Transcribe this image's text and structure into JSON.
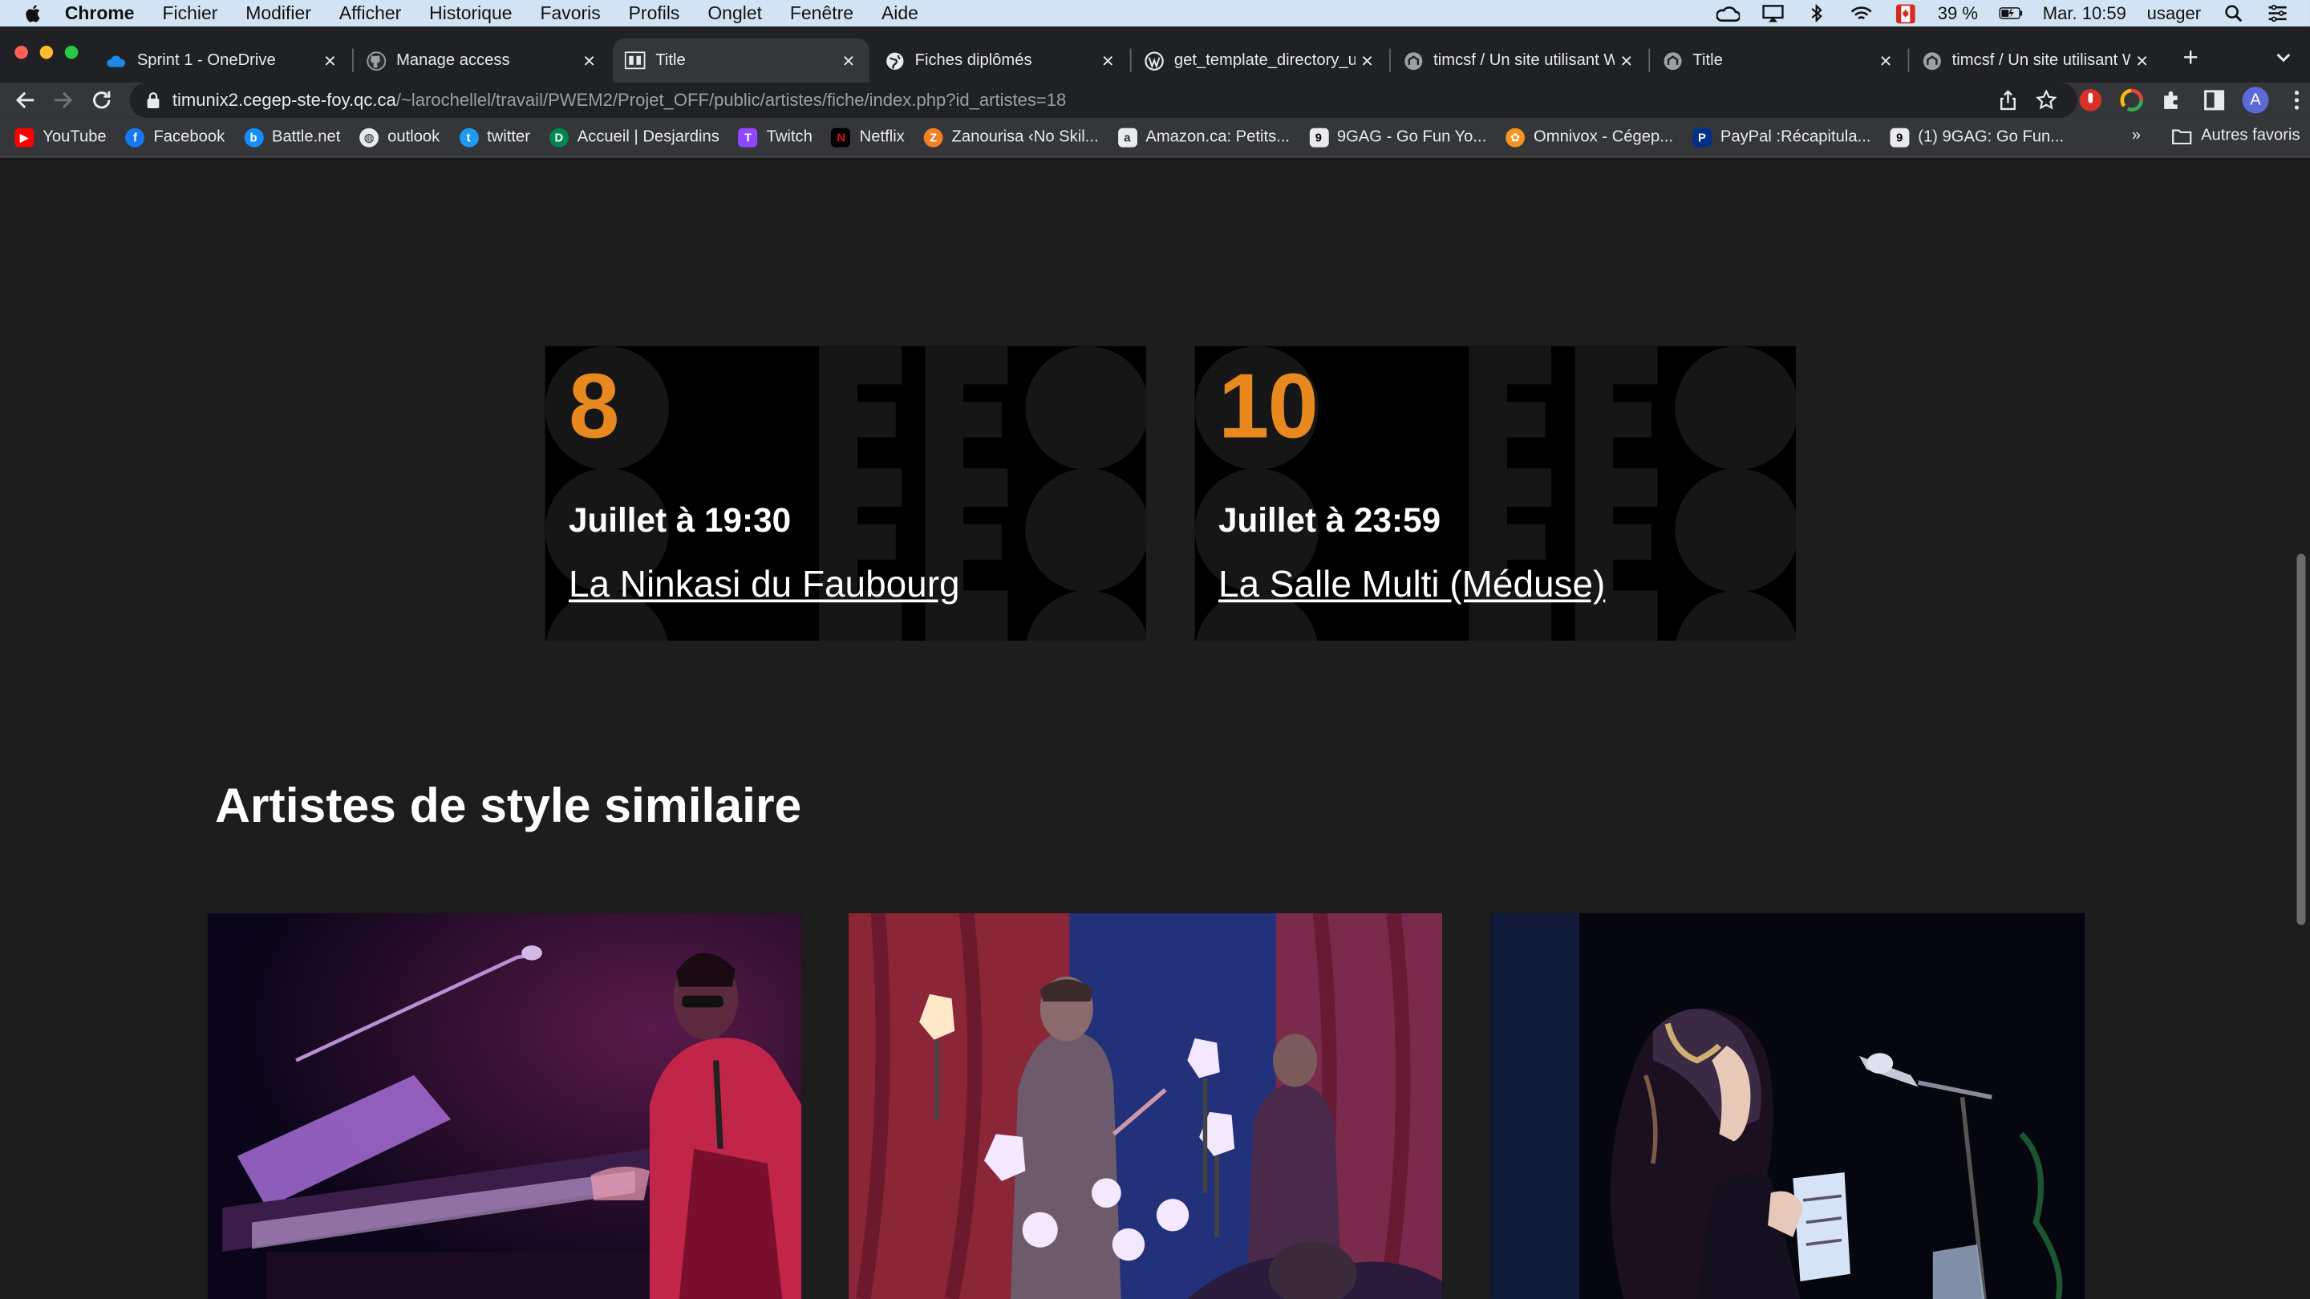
{
  "menubar": {
    "app": "Chrome",
    "items": [
      "Fichier",
      "Modifier",
      "Afficher",
      "Historique",
      "Favoris",
      "Profils",
      "Onglet",
      "Fenêtre",
      "Aide"
    ],
    "battery": "39 %",
    "clock": "Mar. 10:59",
    "user": "usager"
  },
  "tabs": [
    {
      "title": "Sprint 1 - OneDrive",
      "icon": "onedrive-icon",
      "active": false
    },
    {
      "title": "Manage access",
      "icon": "github-icon",
      "active": false
    },
    {
      "title": "Title",
      "icon": "site-logo-icon",
      "active": true
    },
    {
      "title": "Fiches diplômés",
      "icon": "globe-icon",
      "active": false
    },
    {
      "title": "get_template_directory_uri",
      "icon": "wordpress-icon",
      "active": false
    },
    {
      "title": "timcsf / Un site utilisant W",
      "icon": "site-icon",
      "active": false
    },
    {
      "title": "Title",
      "icon": "site-icon",
      "active": false
    },
    {
      "title": "timcsf / Un site utilisant W",
      "icon": "site-icon",
      "active": false
    }
  ],
  "address": {
    "host": "timunix2.cegep-ste-foy.qc.ca",
    "path": "/~larochellel/travail/PWEM2/Projet_OFF/public/artistes/fiche/index.php?id_artistes=18"
  },
  "profile_initial": "A",
  "bookmarks": [
    {
      "label": "YouTube",
      "color": "#ff0000",
      "glyph": "▶"
    },
    {
      "label": "Facebook",
      "color": "#1877f2",
      "glyph": "f"
    },
    {
      "label": "Battle.net",
      "color": "#148eff",
      "glyph": "b"
    },
    {
      "label": "outlook",
      "color": "#5f6368",
      "glyph": "o"
    },
    {
      "label": "twitter",
      "color": "#1d9bf0",
      "glyph": "t"
    },
    {
      "label": "Accueil | Desjardins",
      "color": "#00874e",
      "glyph": "D"
    },
    {
      "label": "Twitch",
      "color": "#9146ff",
      "glyph": "T"
    },
    {
      "label": "Netflix",
      "color": "#e50914",
      "glyph": "N"
    },
    {
      "label": "Zanourisa ‹No Skil...",
      "color": "#f48024",
      "glyph": "Z"
    },
    {
      "label": "Amazon.ca: Petits...",
      "color": "#232f3e",
      "glyph": "a"
    },
    {
      "label": "9GAG - Go Fun Yo...",
      "color": "#000000",
      "glyph": "9"
    },
    {
      "label": "Omnivox - Cégep...",
      "color": "#f7941d",
      "glyph": "✿"
    },
    {
      "label": "PayPal :Récapitula...",
      "color": "#003087",
      "glyph": "P"
    },
    {
      "label": "(1) 9GAG: Go Fun...",
      "color": "#000000",
      "glyph": "9"
    }
  ],
  "bookmarks_more": "»",
  "bookmarks_other": "Autres favoris",
  "events": [
    {
      "day": "8",
      "when": "Juillet à 19:30",
      "venue": "La Ninkasi du Faubourg"
    },
    {
      "day": "10",
      "when": "Juillet à 23:59",
      "venue": "La Salle Multi (Méduse)"
    }
  ],
  "similar": {
    "title": "Artistes de style similaire"
  },
  "colors": {
    "accent": "#e7891f",
    "page_bg": "#1d1d1d",
    "card_bg": "#000000"
  }
}
